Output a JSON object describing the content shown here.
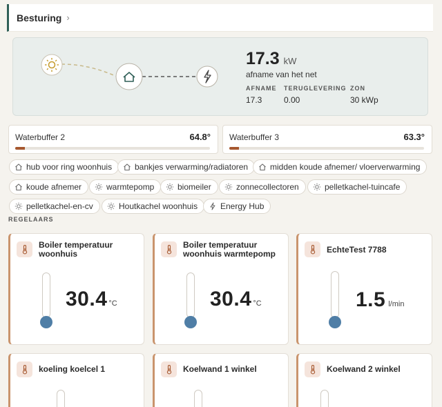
{
  "header": {
    "title": "Besturing",
    "chevron": "›"
  },
  "energy": {
    "value": "17.3",
    "unit": "kW",
    "subtitle": "afname van het net",
    "stats": [
      {
        "label": "AFNAME",
        "value": "17.3"
      },
      {
        "label": "TERUGLEVERING",
        "value": "0.00"
      },
      {
        "label": "ZON",
        "value": "30 kWp"
      }
    ],
    "icons": [
      "sun-icon",
      "home-icon",
      "lightning-icon"
    ]
  },
  "buffers": [
    {
      "name": "Waterbuffer 2",
      "value": "64.8°",
      "level": 0.05
    },
    {
      "name": "Waterbuffer 3",
      "value": "63.3°",
      "level": 0.05
    }
  ],
  "chips": [
    {
      "label": "hub voor ring woonhuis",
      "icon": "home"
    },
    {
      "label": "bankjes verwarming/radiatoren",
      "icon": "home"
    },
    {
      "label": "midden koude afnemer/ vloerverwarming",
      "icon": "home"
    },
    {
      "label": "koude afnemer",
      "icon": "home"
    },
    {
      "label": "warmtepomp",
      "icon": "sun"
    },
    {
      "label": "biomeiler",
      "icon": "sun"
    },
    {
      "label": "zonnecollectoren",
      "icon": "sun"
    },
    {
      "label": "pelletkachel-tuincafe",
      "icon": "sun"
    },
    {
      "label": "pelletkachel-en-cv",
      "icon": "sun"
    },
    {
      "label": "Houtkachel woonhuis",
      "icon": "sun"
    },
    {
      "label": "Energy Hub",
      "icon": "bolt"
    }
  ],
  "section_label": "REGELAARS",
  "cards": [
    {
      "name": "Boiler temperatuur woonhuis",
      "value": "30.4",
      "unit": "°C"
    },
    {
      "name": "Boiler temperatuur woonhuis warmtepomp",
      "value": "30.4",
      "unit": "°C"
    },
    {
      "name": "EchteTest 7788",
      "value": "1.5",
      "unit": "l/min"
    },
    {
      "name": "koeling koelcel 1",
      "value": "",
      "unit": ""
    },
    {
      "name": "Koelwand 1 winkel",
      "value": "",
      "unit": ""
    },
    {
      "name": "Koelwand 2 winkel",
      "value": "",
      "unit": ""
    }
  ],
  "colors": {
    "accent": "#2f5f57",
    "bar": "#a6582f",
    "bulb": "#4f7ea6",
    "card_border": "#c9946d"
  }
}
